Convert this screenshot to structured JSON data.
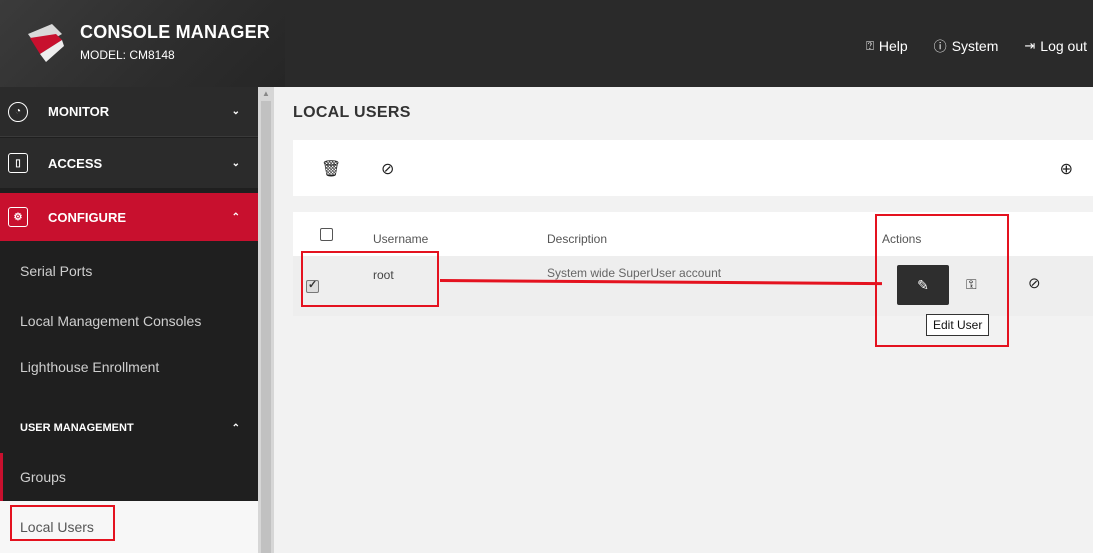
{
  "header": {
    "brand_title": "CONSOLE MANAGER",
    "model": "MODEL: CM8148",
    "nav": [
      {
        "label": "Help",
        "icon": "help-icon",
        "glyph": "⍰"
      },
      {
        "label": "System",
        "icon": "info-icon",
        "glyph": "ⓘ"
      },
      {
        "label": "Log out",
        "icon": "logout-icon",
        "glyph": "⇥"
      }
    ]
  },
  "sidebar": {
    "sections": {
      "monitor": {
        "label": "MONITOR",
        "icon": "gauge-icon",
        "chevron": "⌄"
      },
      "access": {
        "label": "ACCESS",
        "icon": "door-icon",
        "chevron": "⌄"
      },
      "configure": {
        "label": "CONFIGURE",
        "icon": "monitor-settings-icon",
        "chevron": "⌃"
      }
    },
    "links": {
      "serial_ports": "Serial Ports",
      "local_management_consoles": "Local Management Consoles",
      "lighthouse_enrollment": "Lighthouse Enrollment"
    },
    "user_management": {
      "label": "USER MANAGEMENT",
      "chevron": "⌃"
    },
    "um_links": {
      "groups": "Groups",
      "local_users": "Local Users"
    }
  },
  "main": {
    "title": "LOCAL USERS",
    "toolbar": {
      "delete_glyph": "🗑",
      "disable_glyph": "⊘",
      "add_glyph": "⊕"
    },
    "table": {
      "columns": {
        "username": "Username",
        "description": "Description",
        "actions": "Actions"
      },
      "rows": [
        {
          "username": "root",
          "description": "System wide SuperUser account",
          "selected": true
        }
      ],
      "actions": {
        "edit_glyph": "✎",
        "key_glyph": "⚿",
        "ban_glyph": "⊘"
      },
      "tooltip": "Edit User"
    }
  },
  "colors": {
    "accent": "#c8102e",
    "annotation": "#e4121f",
    "header_bg": "#2a2a2a",
    "sidebar_bg": "#1f1f1f"
  }
}
